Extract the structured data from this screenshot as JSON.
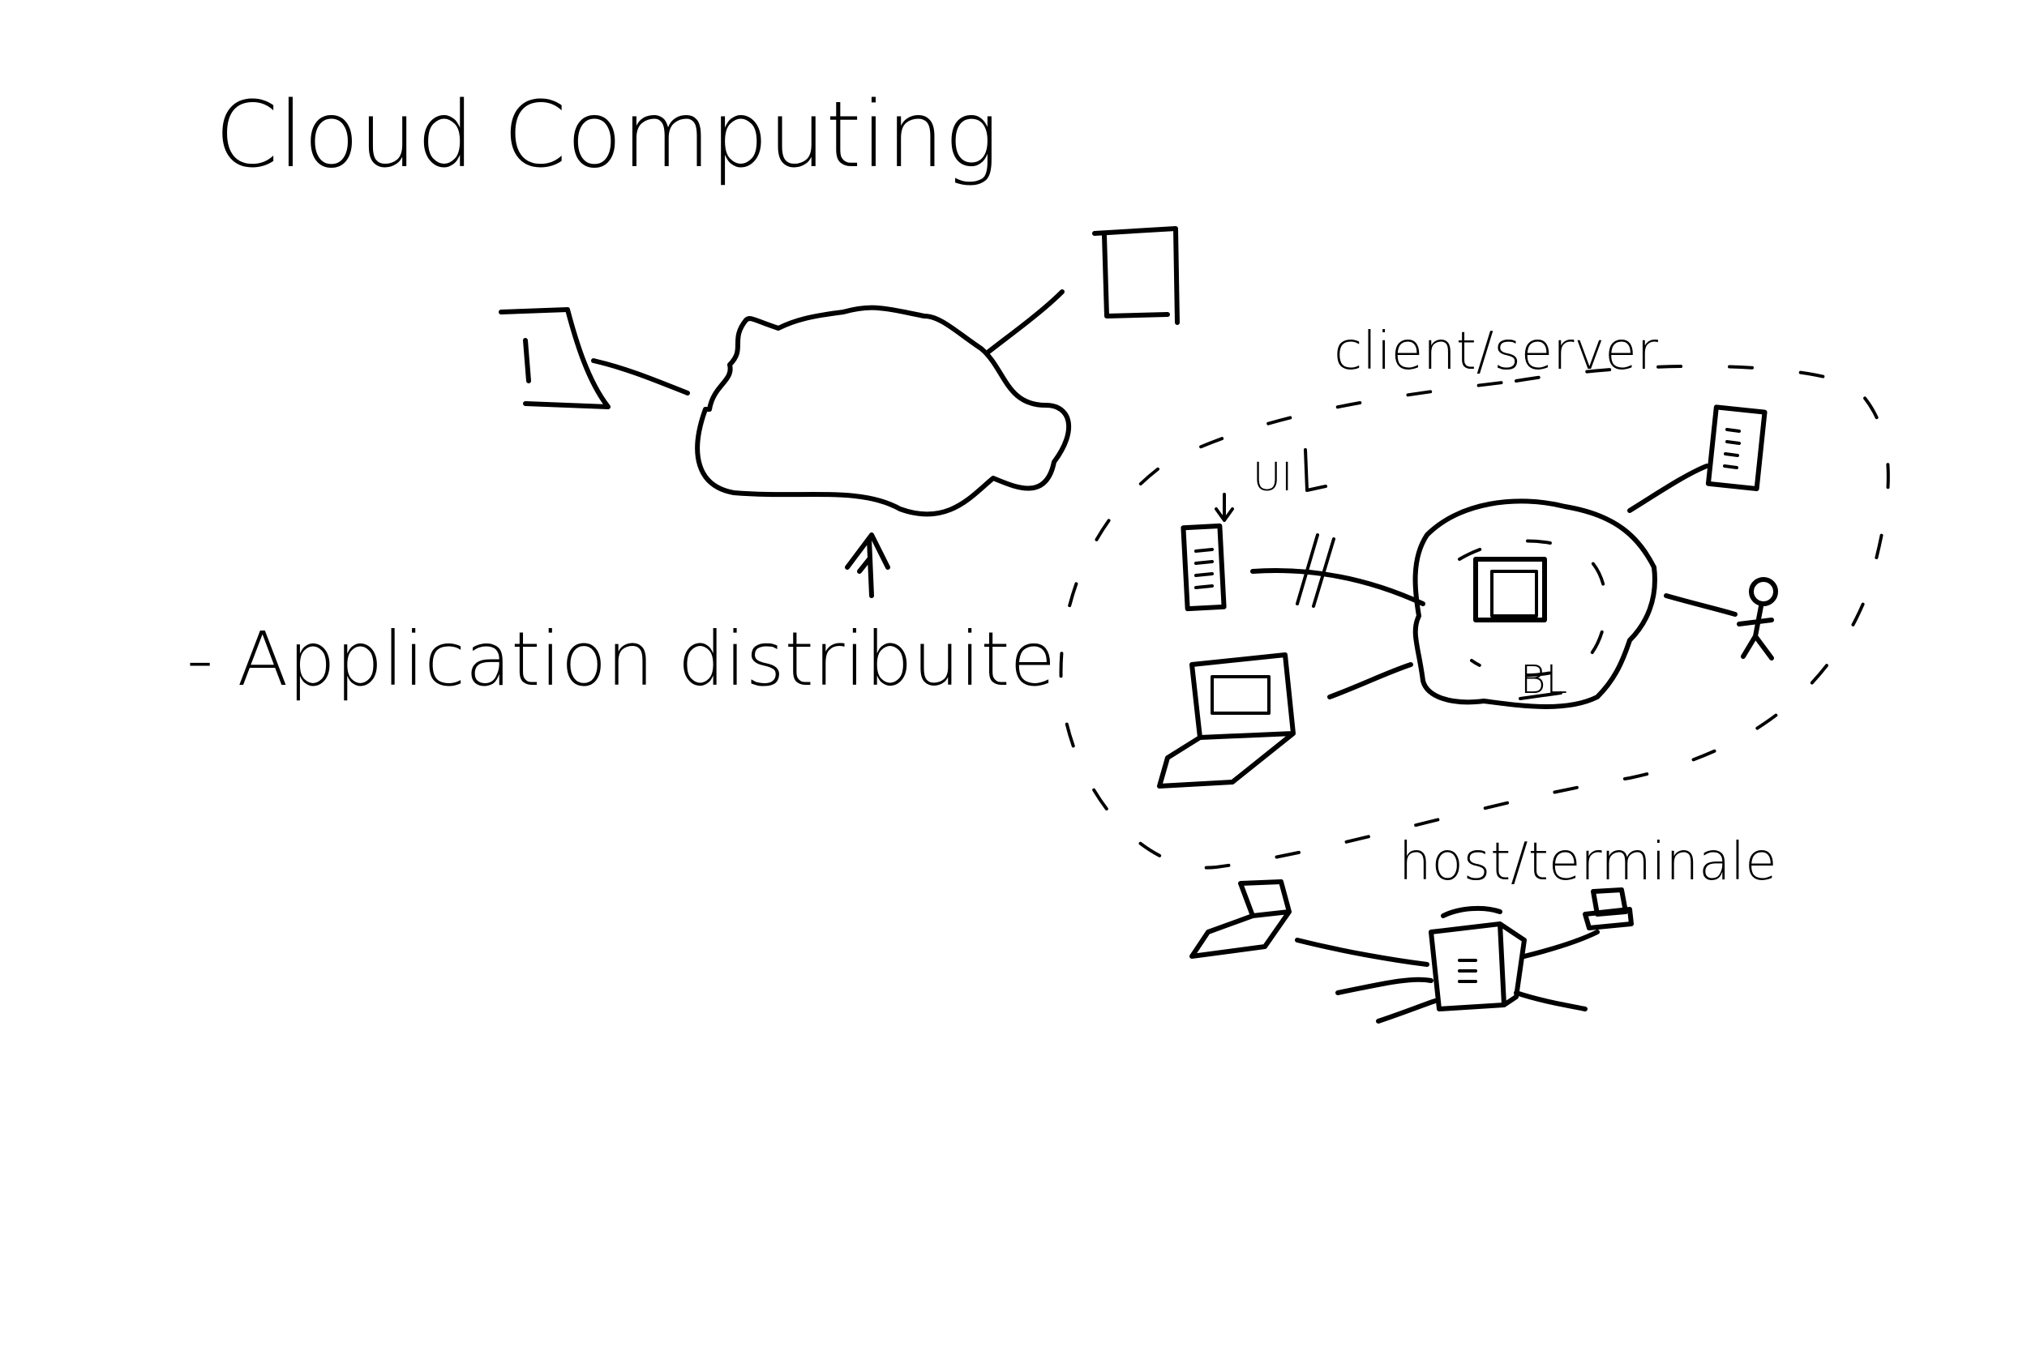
{
  "title": "Cloud Computing",
  "note": "- Application distribuite",
  "labels": {
    "client_server": "client/server",
    "host_terminal": "host/terminale",
    "ui": "UI",
    "bl": "BL"
  },
  "colors": {
    "ink": "#000000",
    "paper": "#ffffff"
  },
  "icons": [
    "cloud-icon",
    "phone-icon",
    "tablet-icon",
    "server-icon",
    "laptop-icon",
    "person-icon",
    "terminal-icon"
  ]
}
